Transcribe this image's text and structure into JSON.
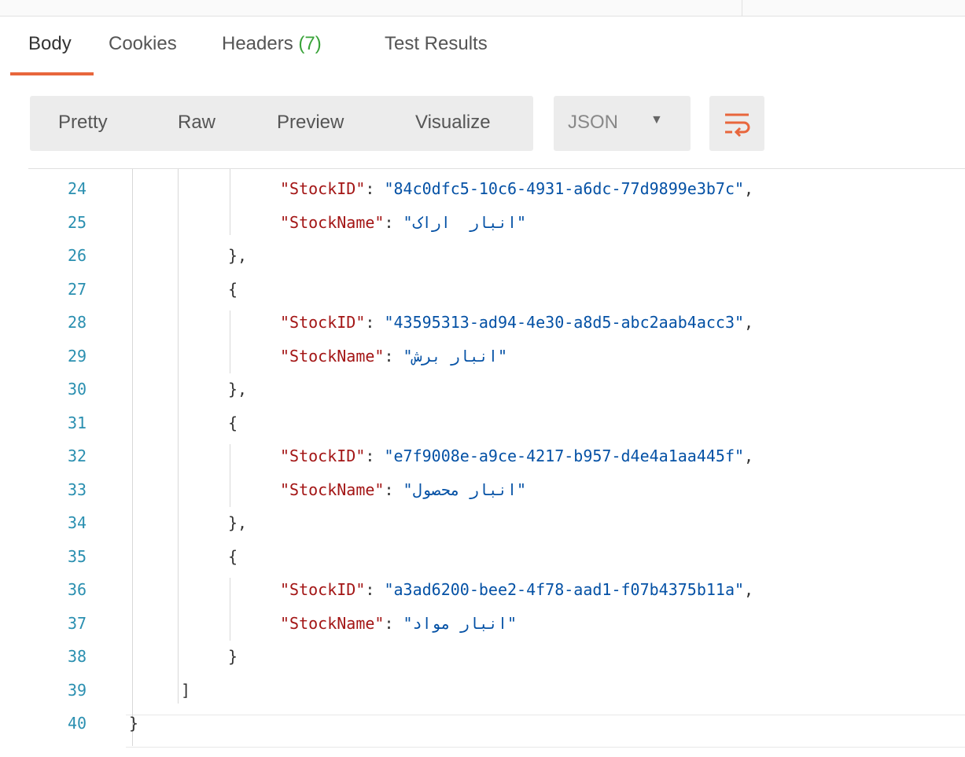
{
  "tabs": [
    {
      "label": "Body"
    },
    {
      "label": "Cookies"
    },
    {
      "label": "Headers ",
      "count": "(7)"
    },
    {
      "label": "Test Results"
    }
  ],
  "toolbar": {
    "view_modes": [
      "Pretty",
      "Raw",
      "Preview",
      "Visualize"
    ],
    "format": "JSON",
    "wrap_icon": "text-wrap-icon"
  },
  "colors": {
    "accent": "#e8663c",
    "count": "#39a339",
    "line_number": "#2a8fb0",
    "key": "#a31515",
    "string": "#0451a5"
  },
  "code": {
    "lines": [
      {
        "n": "24",
        "key": "\"StockID\"",
        "sep": ": ",
        "val": "\"84c0dfc5-10c6-4931-a6dc-77d9899e3b7c\"",
        "tail": ","
      },
      {
        "n": "25",
        "key": "\"StockName\"",
        "sep": ": ",
        "val": "\"انبار  اراک\"",
        "tail": ""
      },
      {
        "n": "26",
        "text": "},"
      },
      {
        "n": "27",
        "text": "{"
      },
      {
        "n": "28",
        "key": "\"StockID\"",
        "sep": ": ",
        "val": "\"43595313-ad94-4e30-a8d5-abc2aab4acc3\"",
        "tail": ","
      },
      {
        "n": "29",
        "key": "\"StockName\"",
        "sep": ": ",
        "val": "\"انبار برش\"",
        "tail": ""
      },
      {
        "n": "30",
        "text": "},"
      },
      {
        "n": "31",
        "text": "{"
      },
      {
        "n": "32",
        "key": "\"StockID\"",
        "sep": ": ",
        "val": "\"e7f9008e-a9ce-4217-b957-d4e4a1aa445f\"",
        "tail": ","
      },
      {
        "n": "33",
        "key": "\"StockName\"",
        "sep": ": ",
        "val": "\"انبار محصول\"",
        "tail": ""
      },
      {
        "n": "34",
        "text": "},"
      },
      {
        "n": "35",
        "text": "{"
      },
      {
        "n": "36",
        "key": "\"StockID\"",
        "sep": ": ",
        "val": "\"a3ad6200-bee2-4f78-aad1-f07b4375b11a\"",
        "tail": ","
      },
      {
        "n": "37",
        "key": "\"StockName\"",
        "sep": ": ",
        "val": "\"انبار مواد\"",
        "tail": ""
      },
      {
        "n": "38",
        "text": "}"
      },
      {
        "n": "39",
        "text": "]"
      },
      {
        "n": "40",
        "text": "}"
      }
    ]
  }
}
